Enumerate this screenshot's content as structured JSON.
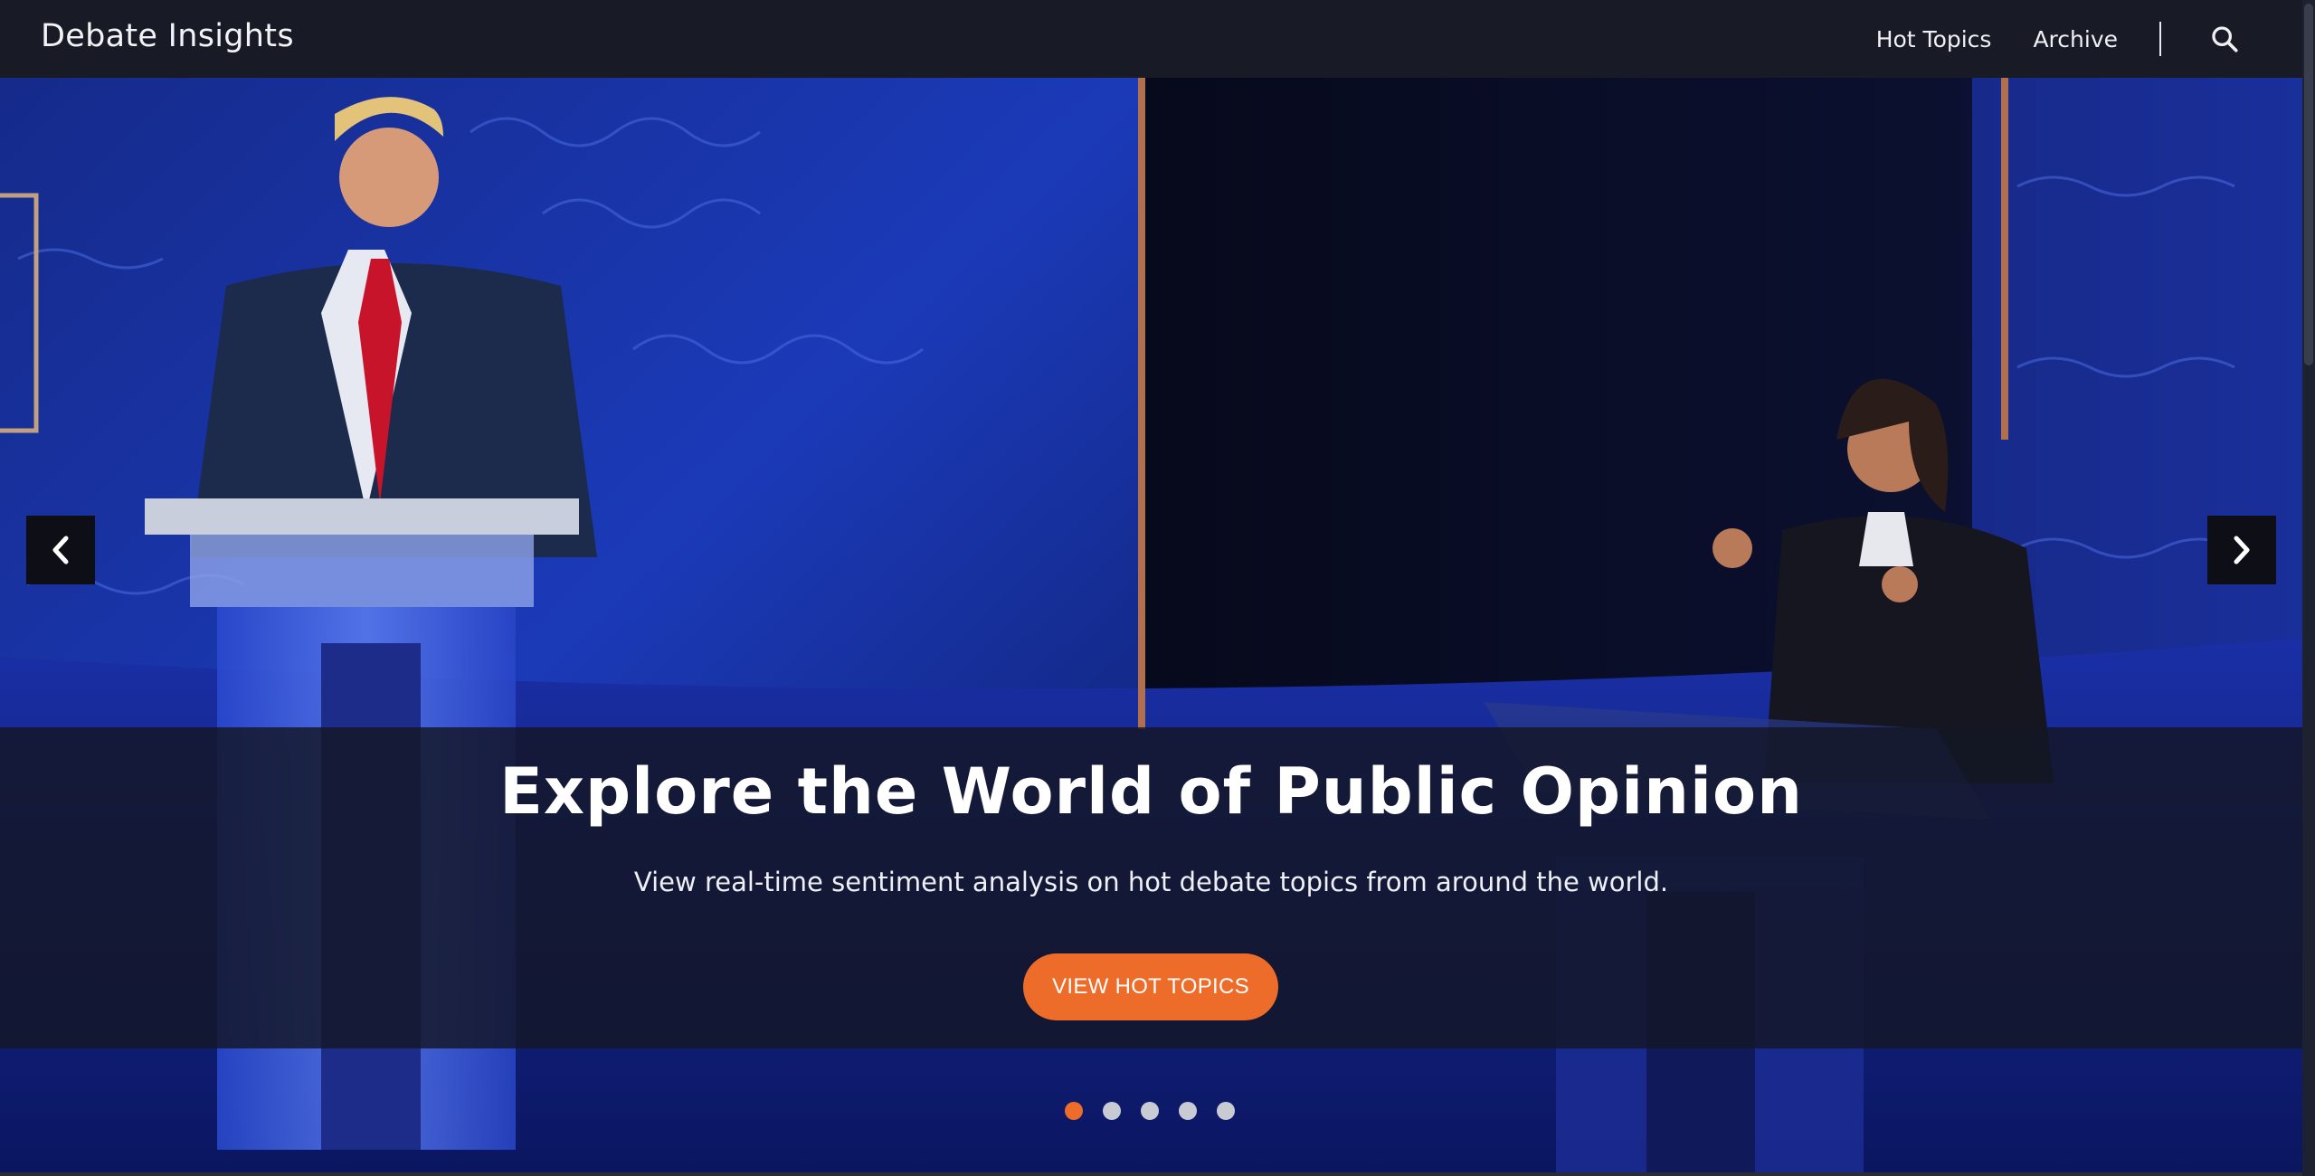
{
  "header": {
    "brand": "Debate Insights",
    "nav": [
      {
        "label": "Hot Topics"
      },
      {
        "label": "Archive"
      }
    ],
    "search_icon": "search-icon"
  },
  "hero": {
    "title": "Explore the World of Public Opinion",
    "subtitle": "View real-time sentiment analysis on hot debate topics from around the world.",
    "cta_label": "VIEW HOT TOPICS",
    "prev_icon": "chevron-left-icon",
    "next_icon": "chevron-right-icon",
    "slides_total": 5,
    "active_slide": 1
  },
  "colors": {
    "header_bg": "#181a26",
    "accent": "#ee6c2a",
    "overlay": "rgba(20,22,36,0.82)"
  }
}
